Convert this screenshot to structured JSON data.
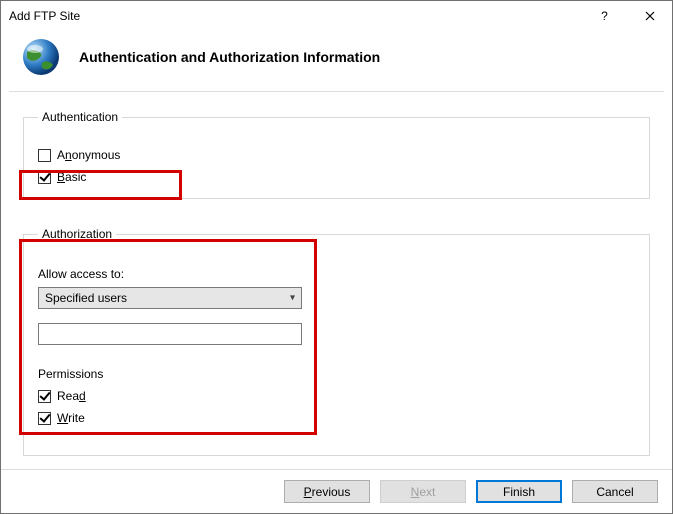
{
  "window": {
    "title": "Add FTP Site"
  },
  "header": {
    "page_title": "Authentication and Authorization Information"
  },
  "auth": {
    "legend": "Authentication",
    "anonymous": {
      "label_pre": "A",
      "label_u": "n",
      "label_post": "onymous",
      "checked": false
    },
    "basic": {
      "label_pre": "",
      "label_u": "B",
      "label_post": "asic",
      "checked": true
    }
  },
  "authz": {
    "legend": "Authorization",
    "allow_label": "Allow access to:",
    "dropdown_value": "Specified users",
    "text_value": "",
    "permissions_label": "Permissions",
    "read": {
      "label_pre": "Rea",
      "label_u": "d",
      "label_post": "",
      "checked": true
    },
    "write": {
      "label_pre": "",
      "label_u": "W",
      "label_post": "rite",
      "checked": true
    }
  },
  "footer": {
    "previous": {
      "pre": "",
      "u": "P",
      "post": "revious"
    },
    "next": {
      "pre": "",
      "u": "N",
      "post": "ext"
    },
    "finish": {
      "text": "Finish"
    },
    "cancel": {
      "text": "Cancel"
    }
  }
}
